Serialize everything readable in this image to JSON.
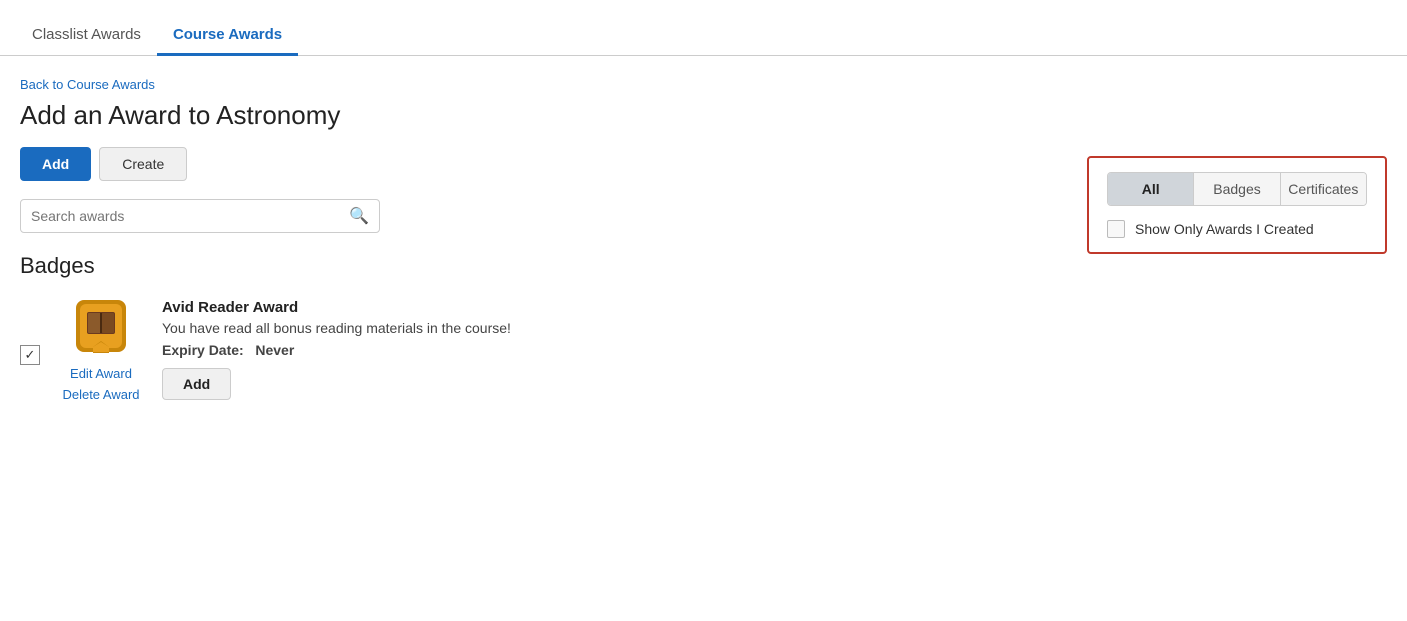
{
  "tabs": [
    {
      "id": "classlist-awards",
      "label": "Classlist Awards",
      "active": false
    },
    {
      "id": "course-awards",
      "label": "Course Awards",
      "active": true
    }
  ],
  "back_link": "Back to Course Awards",
  "page_title": "Add an Award to Astronomy",
  "buttons": {
    "add_label": "Add",
    "create_label": "Create"
  },
  "search": {
    "placeholder": "Search awards"
  },
  "filter_panel": {
    "tabs": [
      {
        "id": "all",
        "label": "All",
        "active": true
      },
      {
        "id": "badges",
        "label": "Badges",
        "active": false
      },
      {
        "id": "certificates",
        "label": "Certificates",
        "active": false
      }
    ],
    "checkbox_label": "Show Only Awards I Created"
  },
  "badges_section_title": "Badges",
  "awards": [
    {
      "name": "Avid Reader Award",
      "description": "You have read all bonus reading materials in the course!",
      "expiry_label": "Expiry Date:",
      "expiry_value": "Never",
      "add_label": "Add",
      "edit_label": "Edit Award",
      "delete_label": "Delete Award",
      "checked": true
    }
  ]
}
